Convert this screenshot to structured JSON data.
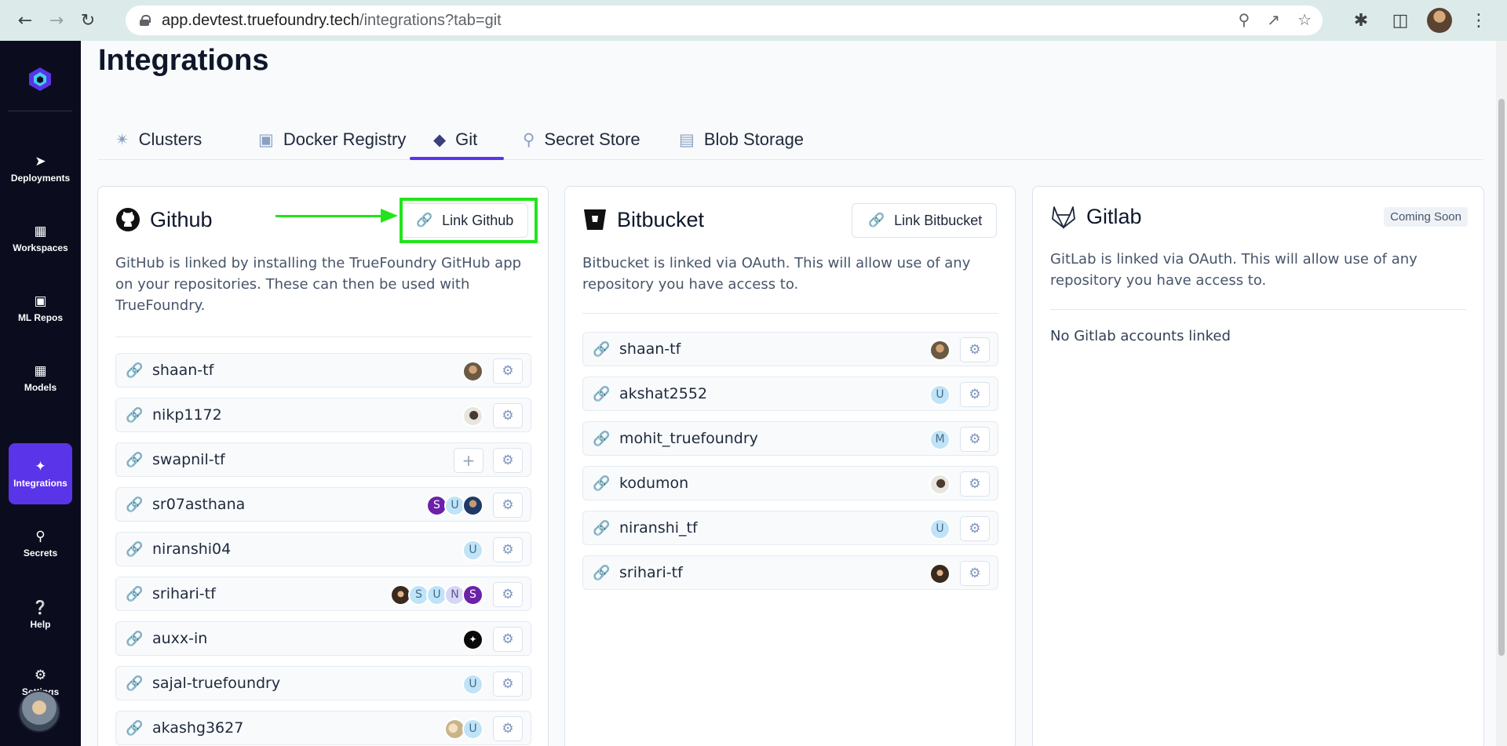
{
  "browser": {
    "url_domain": "app.devtest.truefoundry.tech",
    "url_path": "/integrations?tab=git"
  },
  "sidebar": {
    "items": [
      {
        "label": "Deployments",
        "icon": "rocket-icon"
      },
      {
        "label": "Workspaces",
        "icon": "workspaces-icon"
      },
      {
        "label": "ML Repos",
        "icon": "folder-icon"
      },
      {
        "label": "Models",
        "icon": "table-icon"
      },
      {
        "label": "Integrations",
        "icon": "puzzle-icon",
        "active": true
      },
      {
        "label": "Secrets",
        "icon": "key-icon"
      },
      {
        "label": "Help",
        "icon": "help-icon"
      },
      {
        "label": "Settings",
        "icon": "gear-icon"
      }
    ]
  },
  "page": {
    "title": "Integrations",
    "tabs": [
      {
        "label": "Clusters",
        "icon": "cluster-icon"
      },
      {
        "label": "Docker Registry",
        "icon": "docker-icon"
      },
      {
        "label": "Git",
        "icon": "git-icon",
        "active": true
      },
      {
        "label": "Secret Store",
        "icon": "key-icon"
      },
      {
        "label": "Blob Storage",
        "icon": "storage-icon"
      }
    ]
  },
  "github": {
    "title": "Github",
    "button": "Link Github",
    "description": "GitHub is linked by installing the TrueFoundry GitHub app on your repositories. These can then be used with TrueFoundry.",
    "accounts": [
      {
        "name": "shaan-tf",
        "avatars": [
          "photo1"
        ]
      },
      {
        "name": "nikp1172",
        "avatars": [
          "photo2"
        ]
      },
      {
        "name": "swapnil-tf",
        "avatars": [],
        "add": true
      },
      {
        "name": "sr07asthana",
        "avatars": [
          "S",
          "U",
          "photo3"
        ]
      },
      {
        "name": "niranshi04",
        "avatars": [
          "U"
        ]
      },
      {
        "name": "srihari-tf",
        "avatars": [
          "photo4",
          "S",
          "U",
          "N",
          "S"
        ]
      },
      {
        "name": "auxx-in",
        "avatars": [
          "photo5"
        ]
      },
      {
        "name": "sajal-truefoundry",
        "avatars": [
          "U"
        ]
      },
      {
        "name": "akashg3627",
        "avatars": [
          "photo6",
          "U"
        ]
      }
    ]
  },
  "bitbucket": {
    "title": "Bitbucket",
    "button": "Link Bitbucket",
    "description": "Bitbucket is linked via OAuth. This will allow use of any repository you have access to.",
    "accounts": [
      {
        "name": "shaan-tf",
        "avatar": "photo1"
      },
      {
        "name": "akshat2552",
        "avatar": "U"
      },
      {
        "name": "mohit_truefoundry",
        "avatar": "M"
      },
      {
        "name": "kodumon",
        "avatar": "photo2"
      },
      {
        "name": "niranshi_tf",
        "avatar": "U"
      },
      {
        "name": "srihari-tf",
        "avatar": "photo4"
      }
    ]
  },
  "gitlab": {
    "title": "Gitlab",
    "badge": "Coming Soon",
    "description": "GitLab is linked via OAuth. This will allow use of any repository you have access to.",
    "empty": "No Gitlab accounts linked"
  },
  "colors": {
    "accent": "#5a34e8",
    "highlight": "#22e41c",
    "link_icon": "#19b4bf"
  }
}
